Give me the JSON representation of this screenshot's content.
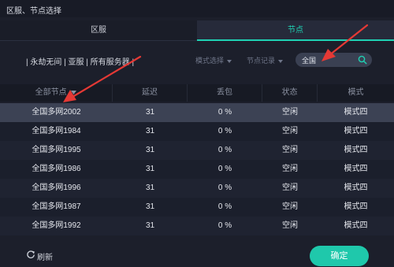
{
  "window": {
    "title": "区服、节点选择"
  },
  "tabs": [
    {
      "label": "区服",
      "active": false
    },
    {
      "label": "节点",
      "active": true
    }
  ],
  "filters": {
    "server_path": "| 永劫无间 | 亚服 | 所有服务器 |",
    "mode_dropdown": "模式选择",
    "record_dropdown": "节点记录",
    "search_value": "全国"
  },
  "table": {
    "columns": [
      "全部节点",
      "延迟",
      "丢包",
      "状态",
      "模式"
    ],
    "rows": [
      {
        "node": "全国多网2002",
        "latency": "31",
        "loss": "0 %",
        "status": "空闲",
        "mode": "模式四",
        "selected": true
      },
      {
        "node": "全国多网1984",
        "latency": "31",
        "loss": "0 %",
        "status": "空闲",
        "mode": "模式四"
      },
      {
        "node": "全国多网1995",
        "latency": "31",
        "loss": "0 %",
        "status": "空闲",
        "mode": "模式四"
      },
      {
        "node": "全国多网1986",
        "latency": "31",
        "loss": "0 %",
        "status": "空闲",
        "mode": "模式四"
      },
      {
        "node": "全国多网1996",
        "latency": "31",
        "loss": "0 %",
        "status": "空闲",
        "mode": "模式四"
      },
      {
        "node": "全国多网1987",
        "latency": "31",
        "loss": "0 %",
        "status": "空闲",
        "mode": "模式四"
      },
      {
        "node": "全国多网1992",
        "latency": "31",
        "loss": "0 %",
        "status": "空闲",
        "mode": "模式四"
      }
    ]
  },
  "footer": {
    "refresh_label": "刷新",
    "confirm_label": "确定"
  },
  "colors": {
    "accent": "#1fc8ab",
    "annotation_arrow": "#e53935"
  }
}
